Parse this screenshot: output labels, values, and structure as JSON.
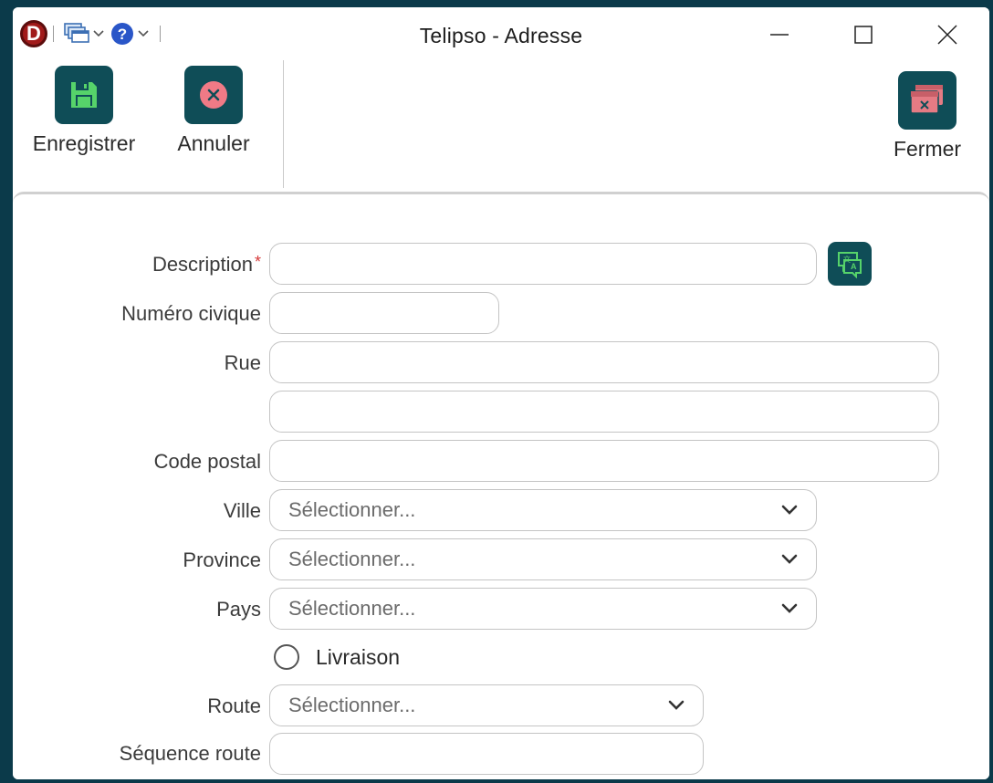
{
  "window": {
    "title": "Telipso - Adresse",
    "logo_letter": "D"
  },
  "toolbar": {
    "save_label": "Enregistrer",
    "cancel_label": "Annuler",
    "close_label": "Fermer"
  },
  "form": {
    "description": {
      "label": "Description",
      "required_mark": "*",
      "value": ""
    },
    "civic_number": {
      "label": "Numéro civique",
      "value": ""
    },
    "street": {
      "label": "Rue",
      "value": "",
      "line2_value": ""
    },
    "postal_code": {
      "label": "Code postal",
      "value": ""
    },
    "city": {
      "label": "Ville",
      "placeholder": "Sélectionner..."
    },
    "province": {
      "label": "Province",
      "placeholder": "Sélectionner..."
    },
    "country": {
      "label": "Pays",
      "placeholder": "Sélectionner..."
    },
    "delivery": {
      "label": "Livraison",
      "checked": false
    },
    "route": {
      "label": "Route",
      "placeholder": "Sélectionner..."
    },
    "route_sequence": {
      "label": "Séquence route",
      "value": ""
    }
  },
  "colors": {
    "accent": "#0f4d57",
    "save_icon": "#56d36a",
    "cancel_icon": "#f07a86",
    "close_icon": "#e57b84",
    "required": "#d63a3a",
    "frame": "#0b3a4a"
  },
  "icons": {
    "app": "app-logo-icon",
    "windows": "windows-icon",
    "help": "help-icon",
    "save": "save-floppy-icon",
    "cancel": "cancel-x-icon",
    "close": "close-window-icon",
    "translate": "translate-icon",
    "dropdown": "chevron-down-icon"
  }
}
